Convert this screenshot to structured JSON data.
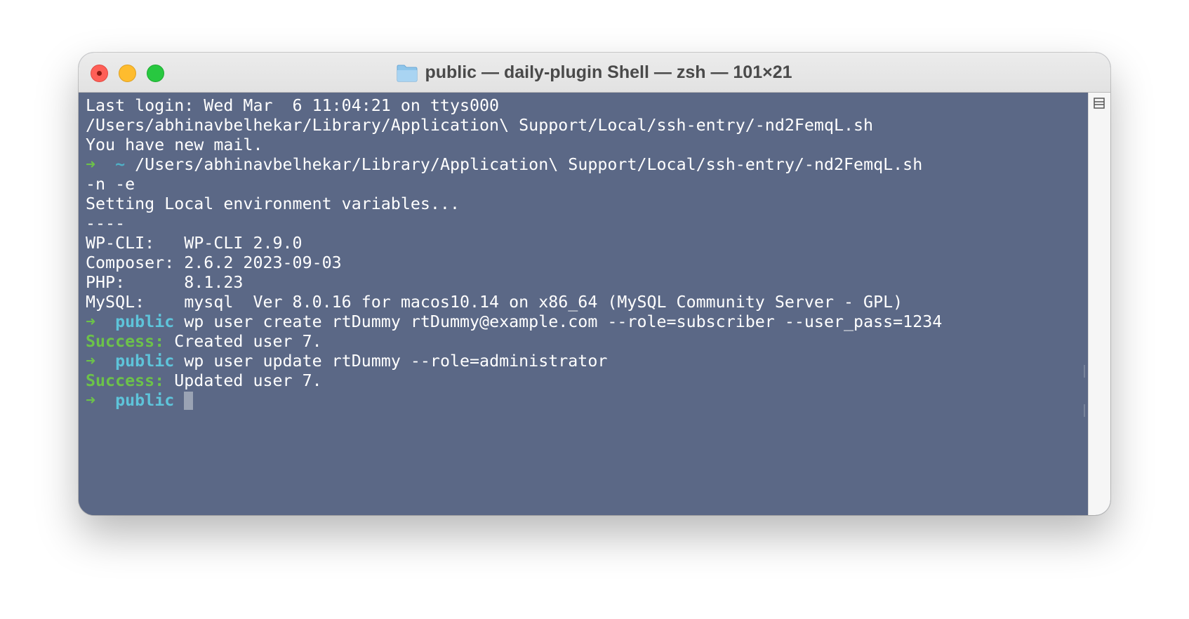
{
  "window": {
    "title": "public — daily-plugin Shell — zsh — 101×21"
  },
  "icons": {
    "folder": "folder-icon",
    "close": "close-icon",
    "minimize": "minimize-icon",
    "zoom": "zoom-icon",
    "split": "split-pane-icon"
  },
  "colors": {
    "terminal_bg": "#5b6886",
    "prompt_arrow": "#6cc24a",
    "prompt_dir": "#5ec4da",
    "success": "#6cc24a"
  },
  "terminal": {
    "lines": {
      "l1": "Last login: Wed Mar  6 11:04:21 on ttys000",
      "l2": "/Users/abhinavbelhekar/Library/Application\\ Support/Local/ssh-entry/-nd2FemqL.sh",
      "l3": "You have new mail.",
      "l4_arrow": "➜",
      "l4_dir": "~",
      "l4_cmd": " /Users/abhinavbelhekar/Library/Application\\ Support/Local/ssh-entry/-nd2FemqL.sh",
      "l5": "-n -e",
      "l6": "Setting Local environment variables...",
      "l7": "----",
      "l8": "WP-CLI:   WP-CLI 2.9.0",
      "l9": "Composer: 2.6.2 2023-09-03",
      "l10": "PHP:      8.1.23",
      "l11": "MySQL:    mysql  Ver 8.0.16 for macos10.14 on x86_64 (MySQL Community Server - GPL)",
      "l12_arrow": "➜",
      "l12_dir": "public",
      "l12_cmd": " wp user create rtDummy rtDummy@example.com --role=subscriber --user_pass=1234",
      "l13_label": "Success:",
      "l13_text": " Created user 7.",
      "l14_arrow": "➜",
      "l14_dir": "public",
      "l14_cmd": " wp user update rtDummy --role=administrator",
      "l15_label": "Success:",
      "l15_text": " Updated user 7.",
      "l16_arrow": "➜",
      "l16_dir": "public"
    }
  }
}
